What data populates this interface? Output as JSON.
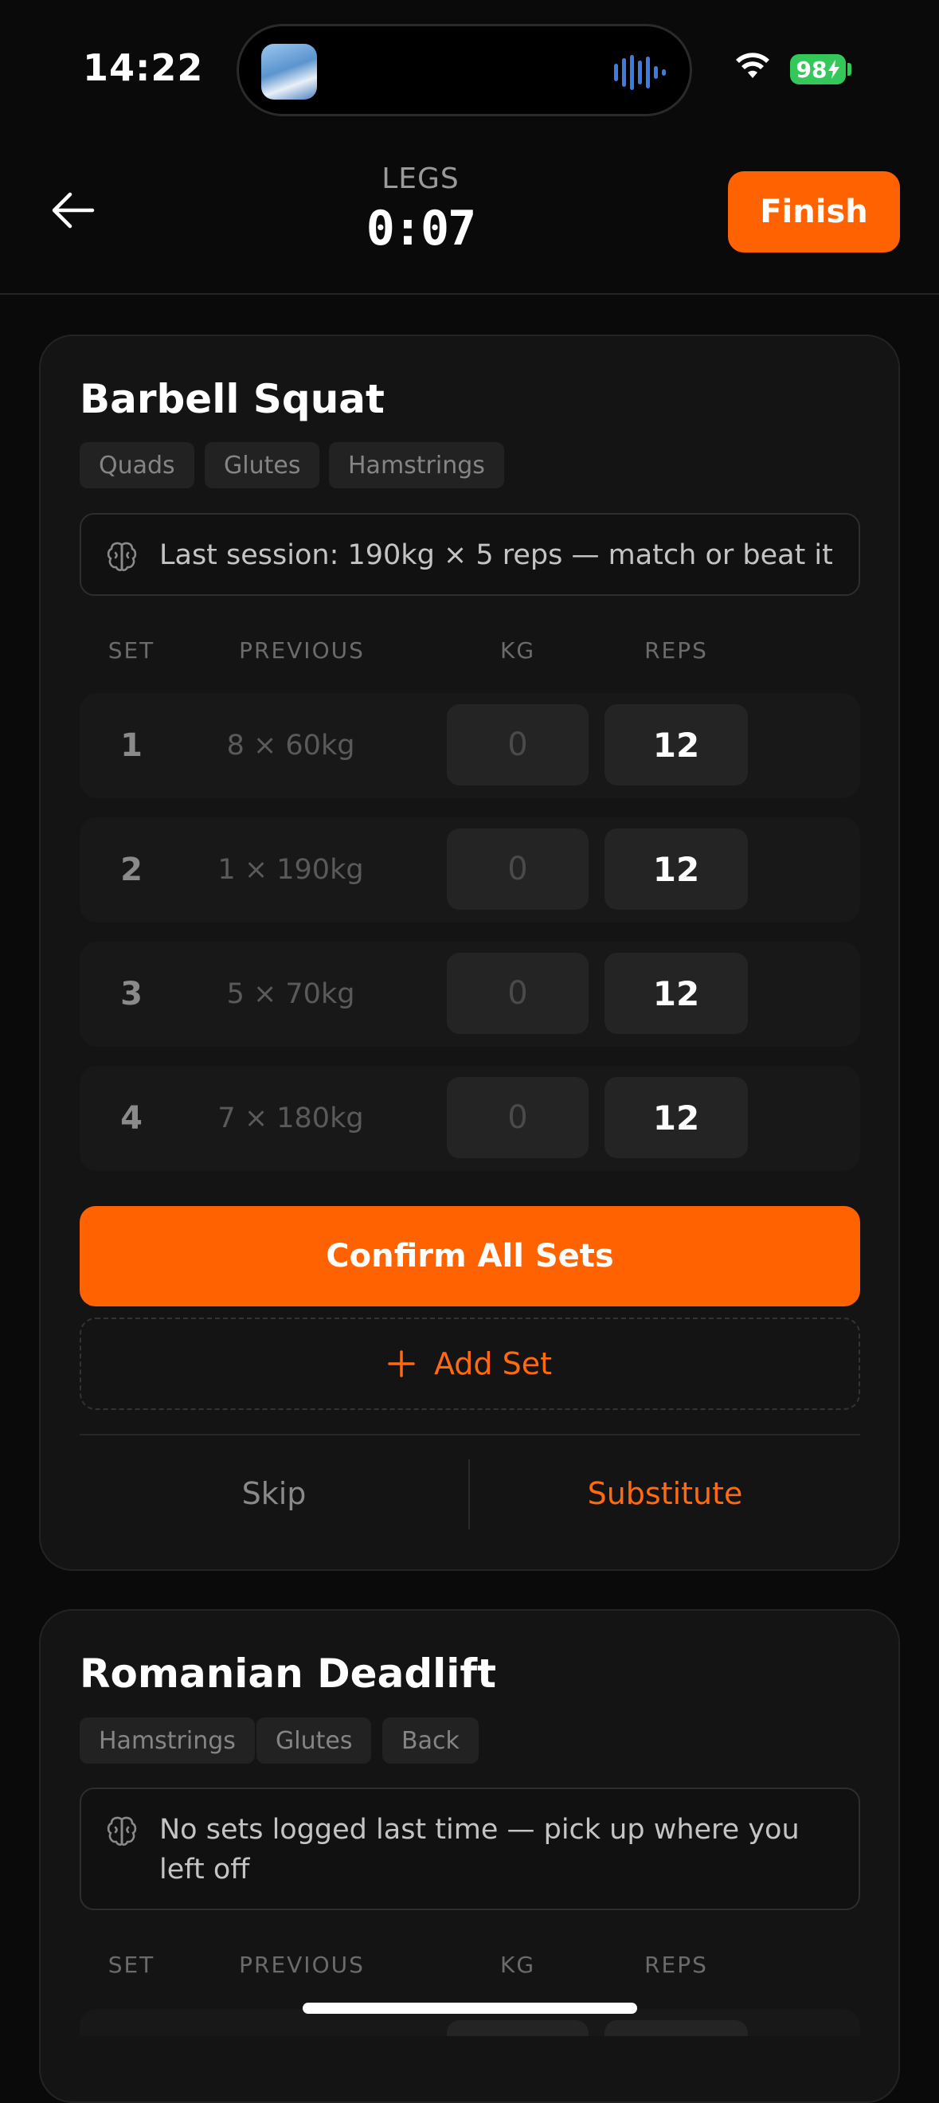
{
  "status_bar": {
    "time": "14:22",
    "battery": "98"
  },
  "header": {
    "workout_name": "LEGS",
    "timer": "0:07",
    "finish_label": "Finish"
  },
  "columns": {
    "set": "SET",
    "previous": "PREVIOUS",
    "kg": "KG",
    "reps": "REPS"
  },
  "exercises": [
    {
      "name": "Barbell Squat",
      "tags": [
        "Quads",
        "Glutes",
        "Hamstrings"
      ],
      "note": "Last session: 190kg × 5 reps — match or beat it",
      "sets": [
        {
          "num": "1",
          "previous": "8 × 60kg",
          "kg": "0",
          "reps": "12"
        },
        {
          "num": "2",
          "previous": "1 × 190kg",
          "kg": "0",
          "reps": "12"
        },
        {
          "num": "3",
          "previous": "5 × 70kg",
          "kg": "0",
          "reps": "12"
        },
        {
          "num": "4",
          "previous": "7 × 180kg",
          "kg": "0",
          "reps": "12"
        }
      ],
      "confirm_label": "Confirm All Sets",
      "add_set_label": "Add Set",
      "skip_label": "Skip",
      "substitute_label": "Substitute"
    },
    {
      "name": "Romanian Deadlift",
      "tags": [
        "Hamstrings",
        "Glutes",
        "Back"
      ],
      "note": "No sets logged last time — pick up where you left off"
    }
  ]
}
